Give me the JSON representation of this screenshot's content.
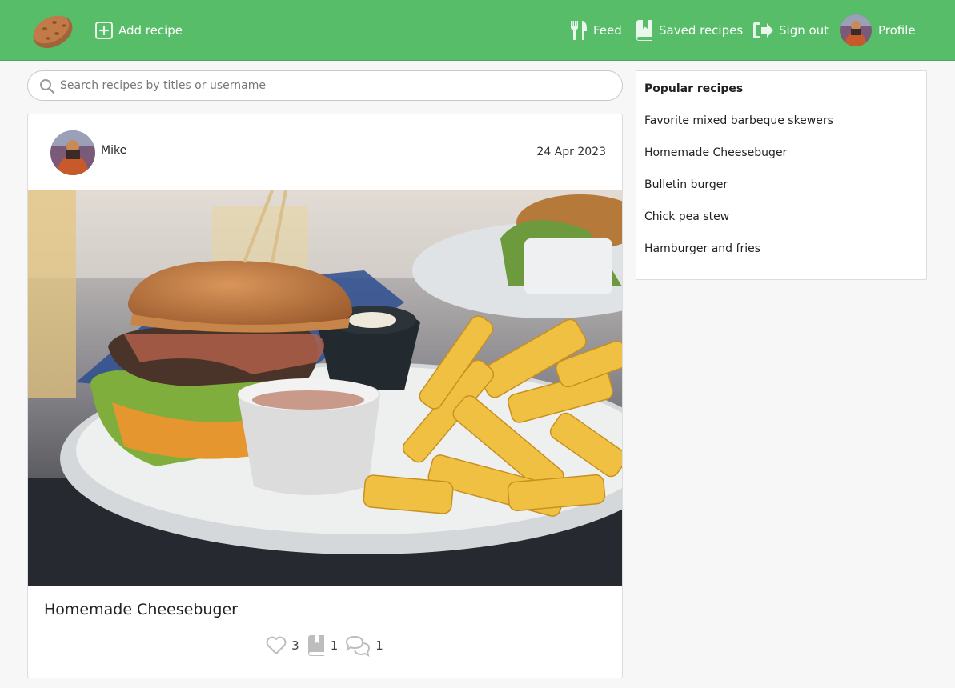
{
  "nav": {
    "add_recipe": "Add recipe",
    "feed": "Feed",
    "saved_recipes": "Saved recipes",
    "sign_out": "Sign out",
    "profile": "Profile",
    "icons": [
      "potato-logo",
      "plus-square-icon",
      "fork-knife-icon",
      "bookmark-book-icon",
      "sign-out-icon",
      "profile-avatar"
    ]
  },
  "search": {
    "placeholder": "Search recipes by titles or username",
    "value": ""
  },
  "post": {
    "username": "Mike",
    "date": "24 Apr 2023",
    "title": "Homemade Cheesebuger",
    "likes": "3",
    "saves": "1",
    "comments": "1"
  },
  "popular": {
    "title": "Popular recipes",
    "items": [
      "Favorite mixed barbeque skewers",
      "Homemade Cheesebuger",
      "Bulletin burger",
      "Chick pea stew",
      "Hamburger and fries"
    ]
  },
  "colors": {
    "brand": "#57bd69",
    "background": "#f7f7f7",
    "card": "#ffffff",
    "icon_gray": "#bdbdbd"
  }
}
